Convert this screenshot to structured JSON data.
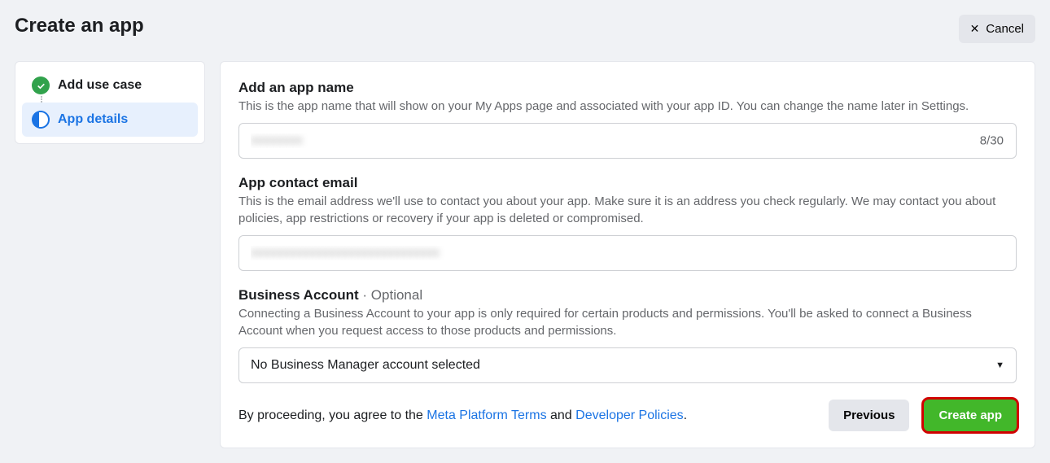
{
  "header": {
    "title": "Create an app",
    "cancel_label": "Cancel"
  },
  "sidebar": {
    "steps": [
      {
        "label": "Add use case",
        "state": "done"
      },
      {
        "label": "App details",
        "state": "active"
      }
    ]
  },
  "sections": {
    "app_name": {
      "title": "Add an app name",
      "desc": "This is the app name that will show on your My Apps page and associated with your app ID. You can change the name later in Settings.",
      "value": "xxxxxxxx",
      "count": "8/30"
    },
    "contact": {
      "title": "App contact email",
      "desc": "This is the email address we'll use to contact you about your app. Make sure it is an address you check regularly. We may contact you about policies, app restrictions or recovery if your app is deleted or compromised.",
      "value": "xxxxxxxxxxxxxxxxxxxxxxxxxxxxx"
    },
    "business": {
      "title": "Business Account",
      "optional_label": " · Optional",
      "desc": "Connecting a Business Account to your app is only required for certain products and permissions. You'll be asked to connect a Business Account when you request access to those products and permissions.",
      "selected": "No Business Manager account selected"
    }
  },
  "footer": {
    "agree_prefix": "By proceeding, you agree to the ",
    "terms_link": "Meta Platform Terms",
    "agree_mid": " and ",
    "policies_link": "Developer Policies",
    "agree_suffix": ".",
    "prev_label": "Previous",
    "create_label": "Create app"
  }
}
